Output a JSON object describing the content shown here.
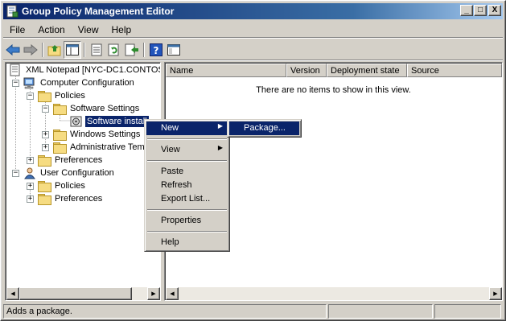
{
  "window": {
    "title": "Group Policy Management Editor"
  },
  "title_buttons": {
    "minimize": "_",
    "maximize": "□",
    "close": "X"
  },
  "menubar": [
    "File",
    "Action",
    "View",
    "Help"
  ],
  "toolbar": [
    "back-icon",
    "forward-icon",
    "up-folder-icon",
    "show-hide-tree-icon",
    "properties-icon",
    "refresh-icon",
    "export-list-icon",
    "help-icon",
    "console-tree-icon"
  ],
  "tree": {
    "root": "XML Notepad [NYC-DC1.CONTOSO",
    "computer_config": "Computer Configuration",
    "cc_policies": "Policies",
    "software_settings": "Software Settings",
    "software_install": "Software install",
    "windows_settings": "Windows Settings",
    "admin_templates": "Administrative Tem",
    "cc_preferences": "Preferences",
    "user_config": "User Configuration",
    "uc_policies": "Policies",
    "uc_preferences": "Preferences"
  },
  "list": {
    "columns": [
      "Name",
      "Version",
      "Deployment state",
      "Source"
    ],
    "empty_message": "There are no items to show in this view."
  },
  "context_menu": {
    "new": "New",
    "view": "View",
    "paste": "Paste",
    "refresh": "Refresh",
    "export_list": "Export List...",
    "properties": "Properties",
    "help": "Help"
  },
  "submenu": {
    "package": "Package..."
  },
  "status": {
    "text": "Adds a package."
  },
  "colors": {
    "selection": "#0a246a",
    "titlebar": "#0a246a",
    "face": "#d4d0c8"
  }
}
